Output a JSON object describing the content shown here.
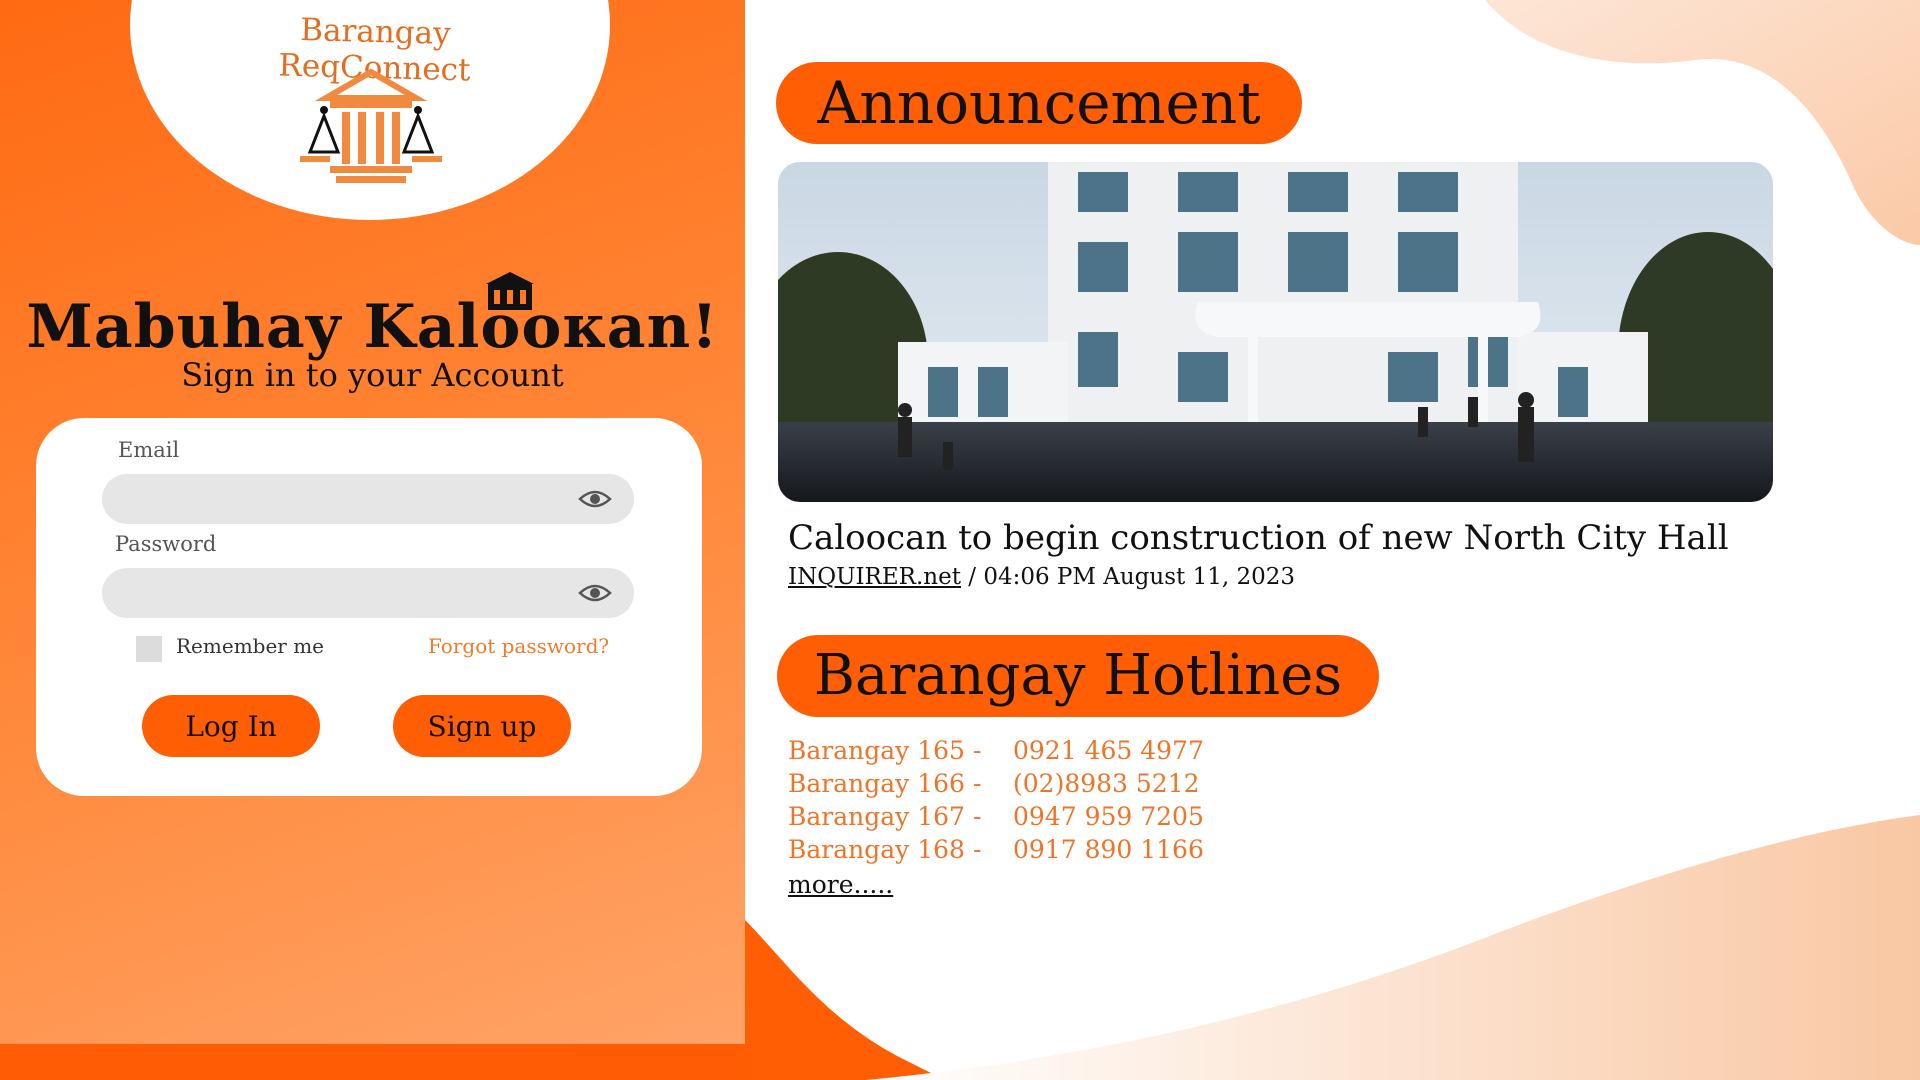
{
  "brand": {
    "name": "Barangay ReqConnect",
    "accent_color": "#ff5e05",
    "brand_text_color": "#e46e20",
    "logo_icon": "justice-building-scales-icon"
  },
  "welcome": {
    "title": "Mabuhay Kaloокan!",
    "subtitle": "Sign in to your Account",
    "title_icon": "house-icon"
  },
  "login_form": {
    "email_label": "Email",
    "email_value": "",
    "password_label": "Password",
    "password_value": "",
    "visibility_icon": "eye-icon",
    "remember_label": "Remember me",
    "remember_checked": false,
    "forgot_label": "Forgot password?",
    "login_label": "Log In",
    "signup_label": "Sign up"
  },
  "announcement": {
    "heading": "Announcement",
    "image_icon": "city-hall-photo",
    "title": "Caloocan to begin construction of new North City Hall",
    "source": "INQUIRER.net",
    "separator": " / ",
    "timestamp": "04:06 PM August 11, 2023"
  },
  "hotlines": {
    "heading": "Barangay Hotlines",
    "items": [
      {
        "name": "Barangay 165",
        "dash": "-",
        "number": "0921 465 4977"
      },
      {
        "name": "Barangay 166",
        "dash": "-",
        "number": "(02)8983 5212"
      },
      {
        "name": "Barangay 167",
        "dash": "-",
        "number": "0947 959 7205"
      },
      {
        "name": "Barangay 168",
        "dash": "-",
        "number": "0917 890 1166"
      }
    ],
    "more_label": "more....."
  }
}
